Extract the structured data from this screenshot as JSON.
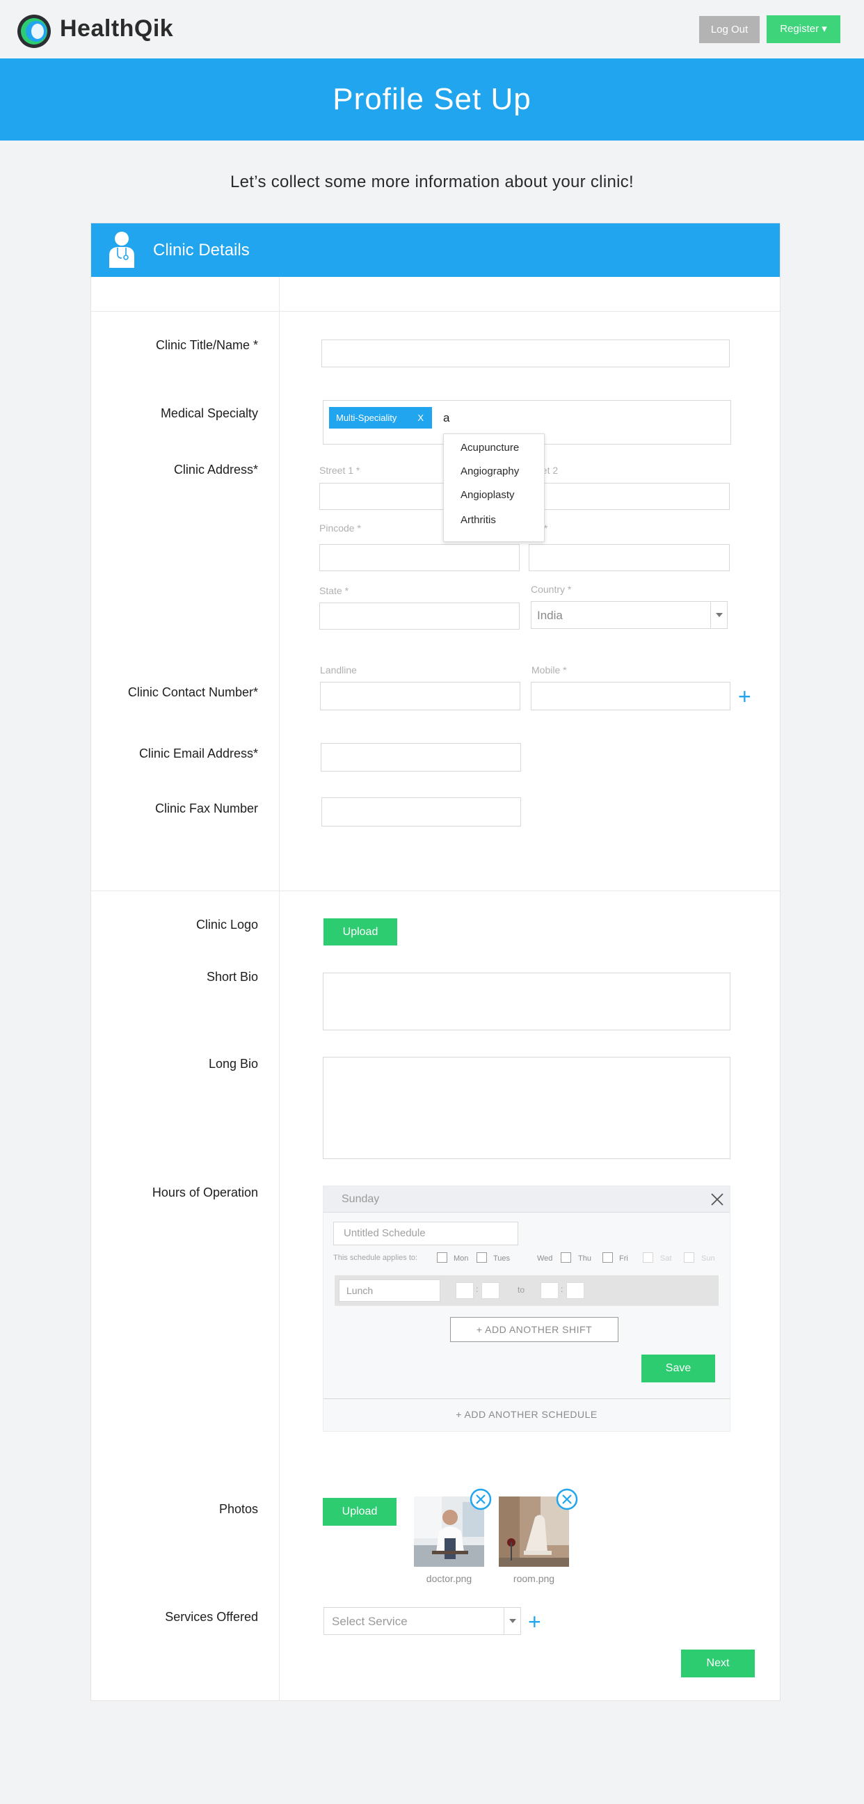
{
  "brand": {
    "name": "HealthQik"
  },
  "nav": {
    "logout_label": "Log Out",
    "register_label": "Register ▾"
  },
  "hero": {
    "title": "Profile Set Up"
  },
  "subtitle": "Let’s collect some more information about your clinic!",
  "section": {
    "title": "Clinic Details"
  },
  "labels": {
    "clinic_name": "Clinic Title/Name *",
    "medical_specialty": "Medical Specialty",
    "clinic_address": "Clinic Address*",
    "contact_number": "Clinic  Contact Number*",
    "email": "Clinic  Email Address*",
    "fax": "Clinic  Fax Number",
    "logo": "Clinic Logo",
    "short_bio": "Short Bio",
    "long_bio": "Long Bio",
    "hours": "Hours of Operation",
    "photos": "Photos",
    "services": "Services Offered"
  },
  "specialty": {
    "tag": "Multi-Speciality",
    "tag_remove": "X",
    "typed": "a",
    "suggestions": [
      "Acupuncture",
      "Angiography",
      "Angioplasty",
      "Arthritis"
    ]
  },
  "address": {
    "street1": "Street 1 *",
    "street2": "eet 2",
    "pincode": "Pincode *",
    "city": "y *",
    "state": "State *",
    "country": "Country *",
    "country_value": "India"
  },
  "contact": {
    "landline": "Landline",
    "mobile": "Mobile *"
  },
  "upload_label": "Upload",
  "schedule": {
    "day": "Sunday",
    "name_placeholder": "Untitled Schedule",
    "applies_to": "This schedule applies to:",
    "days": [
      "Mon",
      "Tues",
      "Wed",
      "Thu",
      "Fri",
      "Sat",
      "Sun"
    ],
    "shift_name": "Lunch",
    "colon": ":",
    "to": "to",
    "add_shift": "+ ADD ANOTHER SHIFT",
    "save": "Save",
    "add_schedule": "+ ADD ANOTHER SCHEDULE"
  },
  "photos": [
    {
      "caption": "doctor.png"
    },
    {
      "caption": "room.png"
    }
  ],
  "services": {
    "placeholder": "Select Service"
  },
  "next_label": "Next",
  "colors": {
    "brand_blue": "#22a5ef",
    "green": "#2ecc71",
    "register_green": "#3dd47a",
    "logout_gray": "#b3b3b3"
  }
}
